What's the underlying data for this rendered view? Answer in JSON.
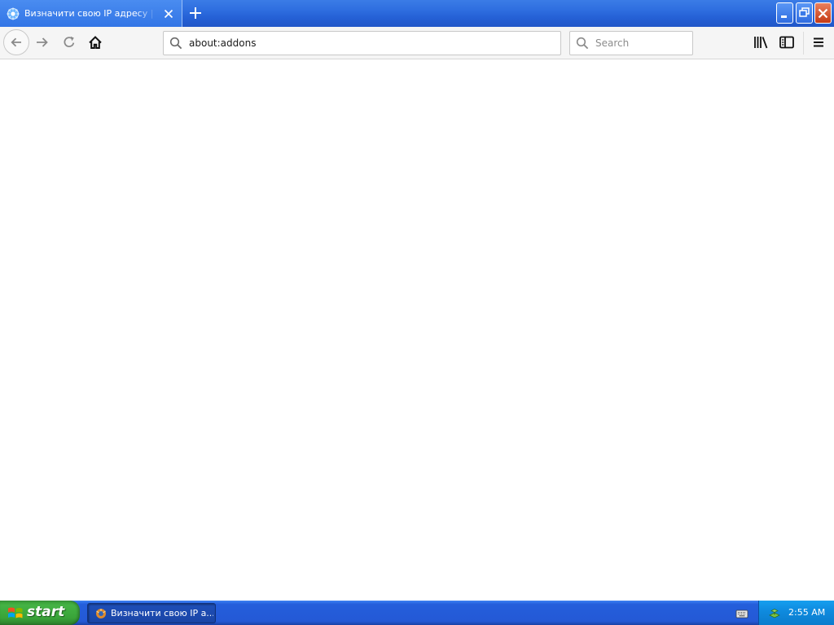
{
  "browser": {
    "tab": {
      "title": "Визначити свою IP адресу | ZIP",
      "favicon": "globe-gear-icon"
    },
    "new_tab_icon": "plus-icon",
    "window_controls": [
      "minimize-icon",
      "restore-icon",
      "close-icon"
    ],
    "toolbar": {
      "back_icon": "arrow-left-icon",
      "forward_icon": "arrow-right-icon",
      "reload_icon": "reload-icon",
      "home_icon": "home-icon",
      "url": "about:addons",
      "search_placeholder": "Search",
      "library_icon": "library-icon",
      "sidebar_icon": "sidebar-icon",
      "menu_icon": "hamburger-menu-icon"
    }
  },
  "taskbar": {
    "start_label": "start",
    "task_item_label": "Визначити свою IP а...",
    "clock": "2:55 AM"
  },
  "colors": {
    "titlebar": "#245fd4",
    "toolbar": "#f5f5f5",
    "taskbar": "#245edb",
    "start_button": "#3ea83e",
    "tray": "#0f8bdf"
  }
}
